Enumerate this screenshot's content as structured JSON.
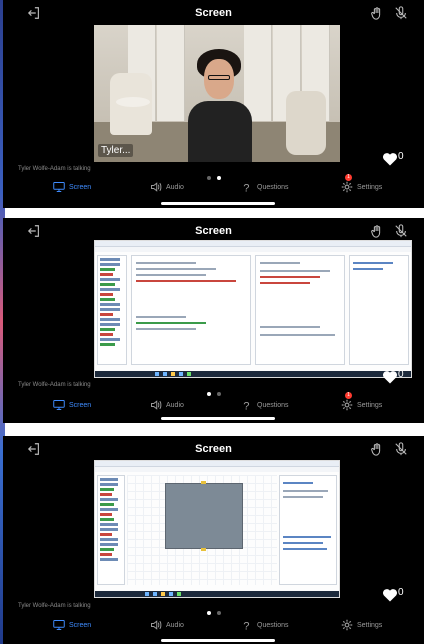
{
  "screen_title": "Screen",
  "talking_status": "Tyler Wolfe-Adam is talking",
  "camera_name_tag": "Tyler...",
  "likes_count": "0",
  "nav": {
    "screen_label": "Screen",
    "audio_label": "Audio",
    "questions_label": "Questions",
    "settings_label": "Settings"
  },
  "settings_badge_count": "1",
  "colors": {
    "active_nav": "#3f8cff",
    "inactive_nav": "#9a9a9a",
    "badge": "#ff3b30",
    "background": "#000000"
  },
  "icons": [
    "exit-icon",
    "raise-hand-icon",
    "microphone-icon",
    "heart-icon",
    "screen-icon",
    "audio-icon",
    "question-icon",
    "gear-icon"
  ],
  "panels": [
    {
      "id": "camera-view",
      "page_dots_active": 1
    },
    {
      "id": "screen-share-editor",
      "page_dots_active": 0
    },
    {
      "id": "screen-share-canvas",
      "page_dots_active": 0
    }
  ]
}
